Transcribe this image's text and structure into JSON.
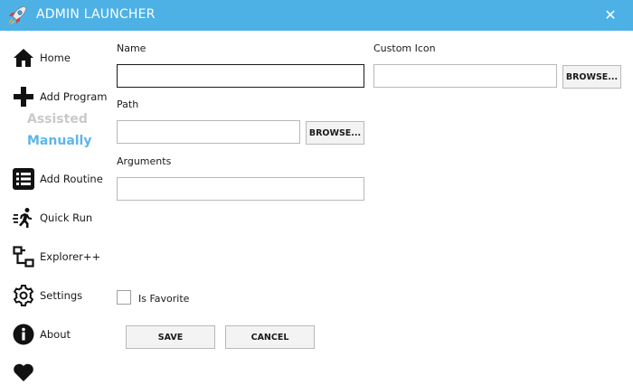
{
  "window": {
    "title": "ADMIN LAUNCHER",
    "close_glyph": "✕",
    "app_icon": "rocket-icon",
    "accent_color": "#4db1e6"
  },
  "sidebar": {
    "items": [
      {
        "label": "Home",
        "icon": "home-icon"
      },
      {
        "label": "Add Program",
        "icon": "plus-icon"
      },
      {
        "label": "Add Routine",
        "icon": "list-icon"
      },
      {
        "label": "Quick Run",
        "icon": "running-icon"
      },
      {
        "label": "Explorer++",
        "icon": "tree-icon"
      },
      {
        "label": "Settings",
        "icon": "gear-icon"
      },
      {
        "label": "About",
        "icon": "info-icon"
      },
      {
        "label": "",
        "icon": "heart-icon"
      }
    ],
    "add_program_sub": {
      "assisted": "Assisted",
      "manually": "Manually",
      "selected": "Manually",
      "selected_color": "#5fb5e8",
      "inactive_color": "#c9c9c9"
    }
  },
  "form": {
    "name": {
      "label": "Name",
      "value": ""
    },
    "path": {
      "label": "Path",
      "value": ""
    },
    "arguments": {
      "label": "Arguments",
      "value": ""
    },
    "custom_icon": {
      "label": "Custom Icon",
      "value": ""
    },
    "browse_label": "BROWSE...",
    "is_favorite": {
      "label": "Is Favorite",
      "checked": false
    },
    "save_label": "SAVE",
    "cancel_label": "CANCEL"
  }
}
